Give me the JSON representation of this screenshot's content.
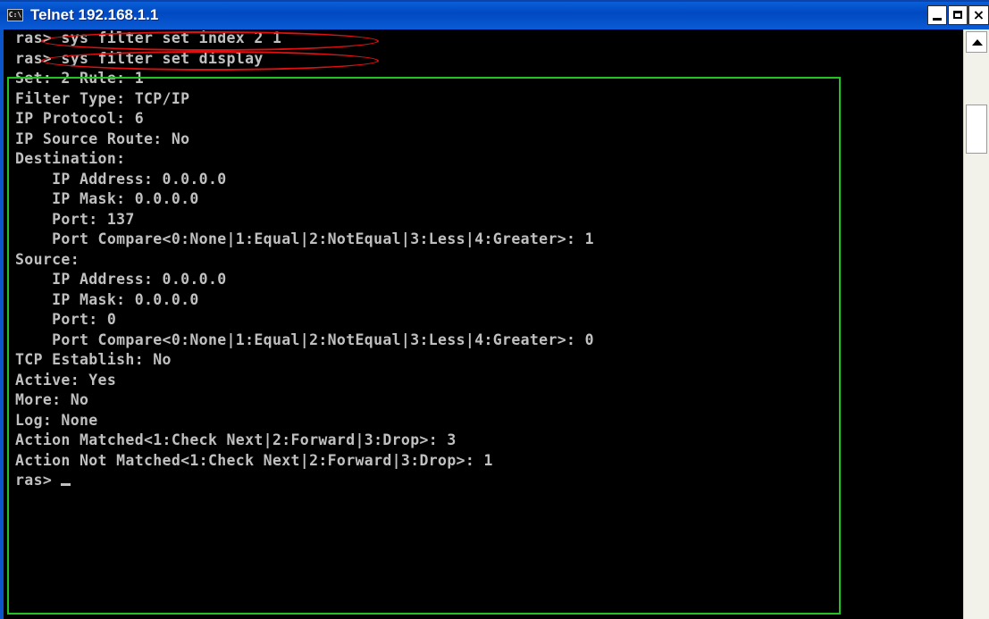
{
  "window": {
    "title": "Telnet 192.168.1.1",
    "icon_label": "C:\\",
    "controls": {
      "minimize": "minimize",
      "maximize": "maximize",
      "close": "×"
    }
  },
  "terminal": {
    "lines": [
      "ras> sys filter set index 2 1",
      "ras> sys filter set display",
      "Set: 2 Rule: 1",
      "Filter Type: TCP/IP",
      "IP Protocol: 6",
      "IP Source Route: No",
      "Destination:",
      "    IP Address: 0.0.0.0",
      "    IP Mask: 0.0.0.0",
      "    Port: 137",
      "    Port Compare<0:None|1:Equal|2:NotEqual|3:Less|4:Greater>: 1",
      "Source:",
      "    IP Address: 0.0.0.0",
      "    IP Mask: 0.0.0.0",
      "    Port: 0",
      "    Port Compare<0:None|1:Equal|2:NotEqual|3:Less|4:Greater>: 0",
      "TCP Establish: No",
      "Active: Yes",
      "More: No",
      "Log: None",
      "Action Matched<1:Check Next|2:Forward|3:Drop>: 3",
      "Action Not Matched<1:Check Next|2:Forward|3:Drop>: 1",
      "ras> "
    ]
  },
  "colors": {
    "terminal_bg": "#000000",
    "terminal_text": "#c0c0c0",
    "title_bar": "#0a5fd8",
    "annotation_red": "#e01010",
    "annotation_green": "#22c422"
  }
}
